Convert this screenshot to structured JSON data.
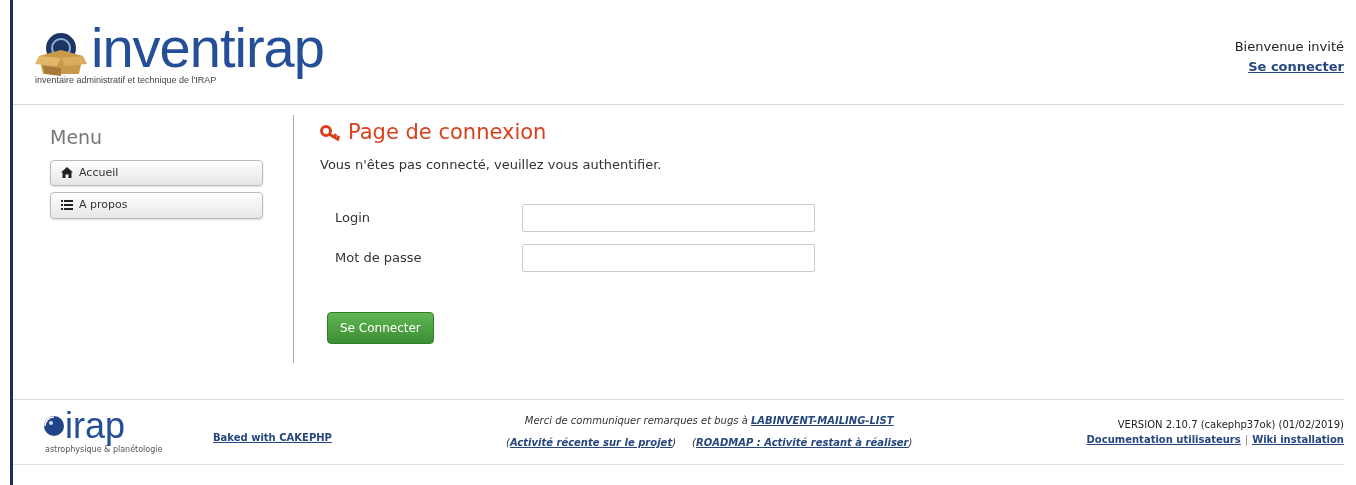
{
  "header": {
    "logo": {
      "name": "inventirap",
      "tagline": "inventaire administratif et technique de l'IRAP"
    },
    "welcome": "Bienvenue invité",
    "login_link": "Se connecter"
  },
  "sidebar": {
    "title": "Menu",
    "items": [
      {
        "label": "Accueil",
        "kind": "home"
      },
      {
        "label": "A propos",
        "kind": "list"
      }
    ]
  },
  "main": {
    "title": "Page de connexion",
    "message": "Vous n'êtes pas connecté, veuillez vous authentifier.",
    "fields": [
      {
        "label": "Login"
      },
      {
        "label": "Mot de passe"
      }
    ],
    "submit": "Se Connecter"
  },
  "footer": {
    "logo": {
      "name": "irap",
      "tagline": "astrophysique & planétologie"
    },
    "baked": "Baked with CAKEPHP",
    "notice": "Merci de communiquer remarques et bugs à",
    "mailing_list": "LABINVENT-MAILING-LIST",
    "links": [
      {
        "open": "(",
        "label": "Activité récente sur le projet",
        "close": ")"
      },
      {
        "open": "(",
        "label": "ROADMAP : Activité restant à réaliser",
        "close": ")"
      }
    ],
    "version": "VERSION 2.10.7 (cakephp37ok) (01/02/2019)",
    "doc_links": [
      "Documentation utilisateurs",
      "Wiki installation"
    ],
    "separator": "|"
  }
}
